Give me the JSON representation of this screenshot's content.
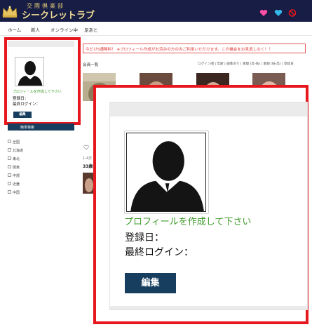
{
  "header": {
    "logo_sub": "交際倶楽部",
    "logo_main": "シークレットラブ",
    "icons": [
      "heart-icon",
      "diamond-icon",
      "forbidden-icon"
    ],
    "icon_colors": [
      "#ff4fa5",
      "#35b7e8",
      "#e0171c"
    ]
  },
  "nav": {
    "items": [
      "ホーム",
      "新人",
      "オンライン中",
      "足あと"
    ]
  },
  "sidebar": {
    "create_profile": "プロフィールを作成して下さい",
    "registered": "登録日：",
    "last_login": "最終ログイン：",
    "edit_button": "編集",
    "search_title": "簡単検索",
    "regions": [
      "全国",
      "北海道",
      "東北",
      "関東",
      "中部",
      "近畿",
      "中国"
    ]
  },
  "main": {
    "notice": "今だけ5通無料！ ※プロフィール作成がお済みの方のみご利用いただけます。この機会をお見逃しなく！！",
    "list_title": "会員一覧",
    "sort_options": "ログイン順 | 年齢 | 画像あり | 金額 (高-低) | 金額 (低-高) | 登録日",
    "member_meta": "1-4万",
    "member_age": "33歳"
  },
  "zoom": {
    "create_profile": "プロフィールを作成して下さい",
    "registered": "登録日：",
    "last_login": "最終ログイン：",
    "edit_button": "編集"
  },
  "colors": {
    "header_bg": "#171d44",
    "highlight_red": "#e7171e",
    "button_navy": "#173e5e",
    "create_green": "#3f9a2c"
  }
}
